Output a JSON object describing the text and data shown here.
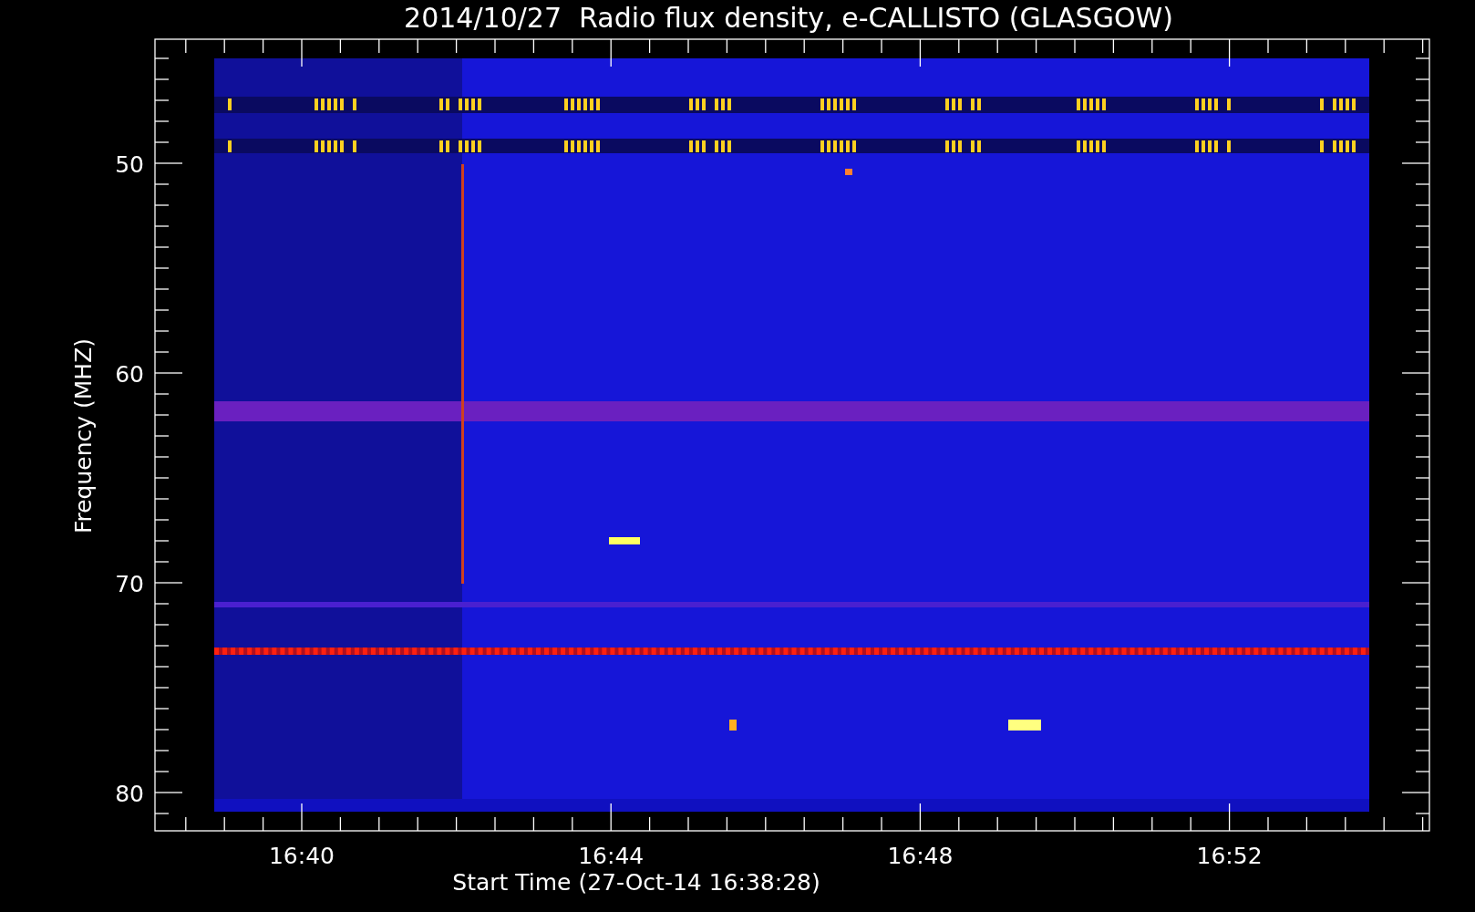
{
  "plot": {
    "title": "2014/10/27  Radio flux density, e-CALLISTO (GLASGOW)",
    "xlabel": "Start Time (27-Oct-14 16:38:28)",
    "ylabel": "Frequency (MHZ)",
    "x_tick_labels": [
      "16:40",
      "16:44",
      "16:48",
      "16:52"
    ],
    "y_tick_labels": [
      "50",
      "60",
      "70",
      "80"
    ]
  }
}
